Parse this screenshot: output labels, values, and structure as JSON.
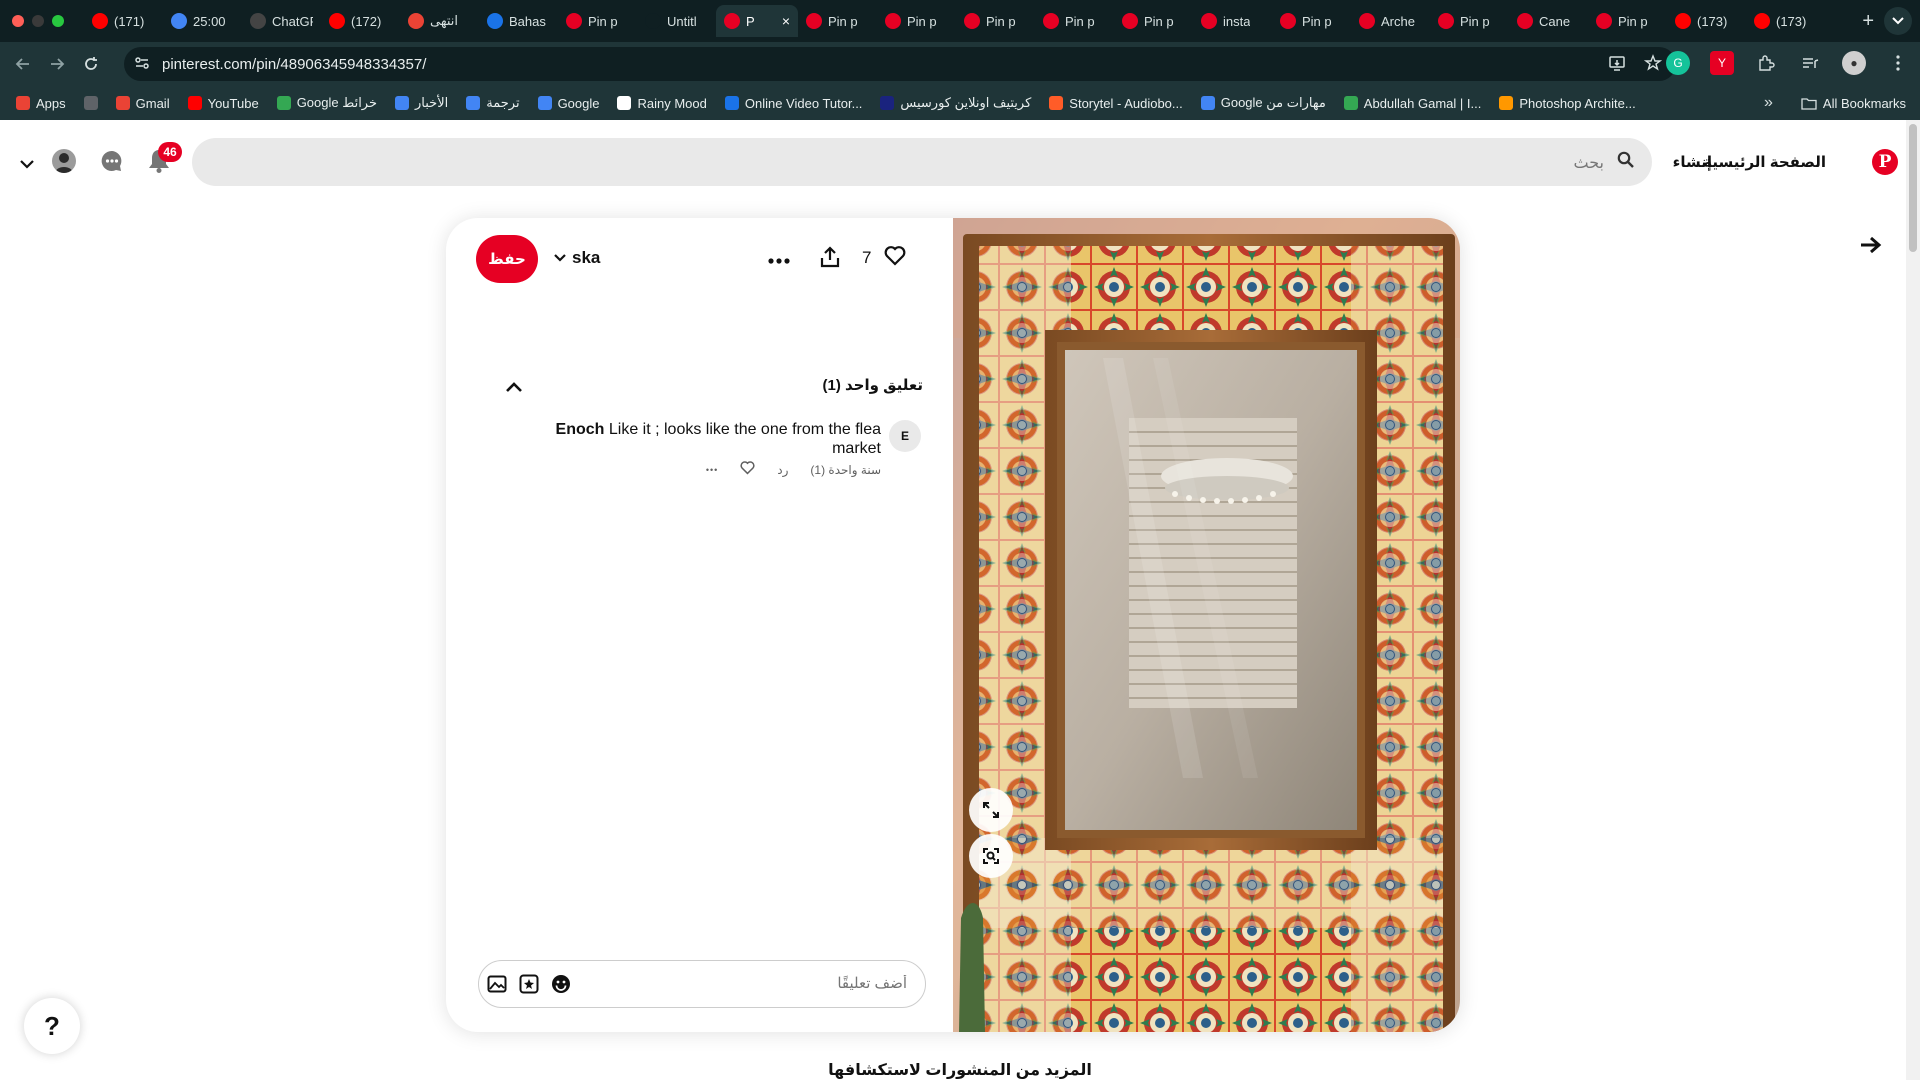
{
  "tabs": [
    {
      "label": "(171)",
      "icon": "youtube-icon",
      "color": "#ff0000"
    },
    {
      "label": "25:00",
      "icon": "google-icon",
      "color": "#4285f4"
    },
    {
      "label": "ChatGPT",
      "icon": "chatgpt-icon",
      "color": "#444444"
    },
    {
      "label": "(172)",
      "icon": "youtube-icon",
      "color": "#ff0000"
    },
    {
      "label": "انتهى",
      "icon": "gmail-icon",
      "color": "#ea4335"
    },
    {
      "label": "Bahas",
      "icon": "document-icon",
      "color": "#1a73e8"
    },
    {
      "label": "Pin p",
      "icon": "pinterest-icon",
      "color": "#e60023"
    },
    {
      "label": "Untitl",
      "icon": "figma-icon",
      "color": "#0f1f22"
    },
    {
      "label": "P",
      "icon": "pinterest-icon",
      "color": "#e60023",
      "active": true
    },
    {
      "label": "Pin p",
      "icon": "pinterest-icon",
      "color": "#e60023"
    },
    {
      "label": "Pin p",
      "icon": "pinterest-icon",
      "color": "#e60023"
    },
    {
      "label": "Pin p",
      "icon": "pinterest-icon",
      "color": "#e60023"
    },
    {
      "label": "Pin p",
      "icon": "pinterest-icon",
      "color": "#e60023"
    },
    {
      "label": "Pin p",
      "icon": "pinterest-icon",
      "color": "#e60023"
    },
    {
      "label": "insta",
      "icon": "pinterest-icon",
      "color": "#e60023"
    },
    {
      "label": "Pin p",
      "icon": "pinterest-icon",
      "color": "#e60023"
    },
    {
      "label": "Arche",
      "icon": "pinterest-icon",
      "color": "#e60023"
    },
    {
      "label": "Pin p",
      "icon": "pinterest-icon",
      "color": "#e60023"
    },
    {
      "label": "Cane",
      "icon": "pinterest-icon",
      "color": "#e60023"
    },
    {
      "label": "Pin p",
      "icon": "pinterest-icon",
      "color": "#e60023"
    },
    {
      "label": "(173)",
      "icon": "youtube-icon",
      "color": "#ff0000"
    },
    {
      "label": "(173)",
      "icon": "youtube-icon",
      "color": "#ff0000"
    }
  ],
  "browser": {
    "url": "pinterest.com/pin/48906345948334357/",
    "close_glyph": "×",
    "newtab_glyph": "+"
  },
  "bookmarks": [
    {
      "label": "Apps",
      "icon": "apps-grid-icon",
      "color": "#ea4335"
    },
    {
      "label": "",
      "icon": "tab-groups-icon",
      "color": "#5f6368"
    },
    {
      "label": "Gmail",
      "icon": "gmail-icon",
      "color": "#ea4335"
    },
    {
      "label": "YouTube",
      "icon": "youtube-icon",
      "color": "#ff0000"
    },
    {
      "label": "Google خرائط",
      "icon": "maps-icon",
      "color": "#34a853"
    },
    {
      "label": "الأخبار",
      "icon": "news-icon",
      "color": "#4285f4"
    },
    {
      "label": "ترجمة",
      "icon": "translate-icon",
      "color": "#4285f4"
    },
    {
      "label": "Google",
      "icon": "google-icon",
      "color": "#4285f4"
    },
    {
      "label": "Rainy Mood",
      "icon": "rain-icon",
      "color": "#ffffff"
    },
    {
      "label": "Online Video Tutor...",
      "icon": "video-icon",
      "color": "#1a73e8"
    },
    {
      "label": "كريتيف اونلاين كورسيس",
      "icon": "course-icon",
      "color": "#1a237e"
    },
    {
      "label": "Storytel - Audiobo...",
      "icon": "storytel-icon",
      "color": "#ff5c28"
    },
    {
      "label": "Google مهارات من",
      "icon": "google-icon",
      "color": "#4285f4"
    },
    {
      "label": "Abdullah Gamal | I...",
      "icon": "star-icon",
      "color": "#34a853"
    },
    {
      "label": "Photoshop Archite...",
      "icon": "photoshop-icon",
      "color": "#ff9800"
    }
  ],
  "bookmarks_more": "»",
  "all_bookmarks": "All Bookmarks",
  "header": {
    "home": "الصفحة الرئيسية",
    "create": "إنشاء",
    "search_placeholder": "بحث",
    "notifications_count": "46",
    "logo_letter": "P"
  },
  "pin": {
    "save_label": "حفظ",
    "board_name": "ska",
    "like_count": "7",
    "more_glyph": "•••",
    "comments_title": "تعليق واحد (1)",
    "comment": {
      "avatar_letter": "E",
      "author": "Enoch",
      "text": "Like it ; looks like the one from the flea market",
      "time": "سنة واحدة (1)",
      "reply": "رد",
      "more_glyph": "•••"
    },
    "comment_placeholder": "أضف تعليقًا"
  },
  "more_to_explore": "المزيد من المنشورات لاستكشافها",
  "help_label": "?",
  "next_arrow": "➜",
  "colors": {
    "brand_red": "#e60023",
    "chrome_dark": "#0f1f22",
    "chrome_mid": "#1f3538"
  }
}
